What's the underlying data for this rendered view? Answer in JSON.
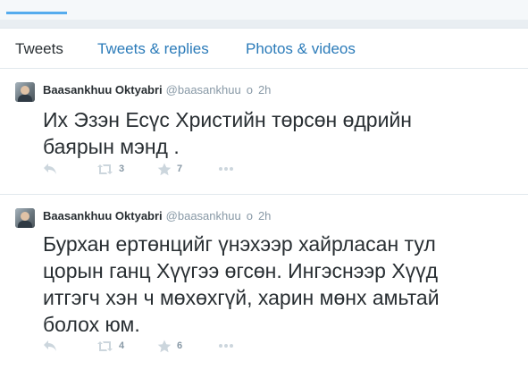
{
  "tabs": [
    {
      "label": "Tweets",
      "active": true
    },
    {
      "label": "Tweets & replies",
      "active": false
    },
    {
      "label": "Photos & videos",
      "active": false
    }
  ],
  "tweets": [
    {
      "name": "Baasankhuu Oktyabri",
      "handle": "@baasankhuu",
      "dot": "o",
      "time": "2h",
      "text": "Их Эзэн Есүс Христийн төрсөн өдрийн\nбаярын мэнд .",
      "retweets": "3",
      "favorites": "7",
      "icons": [
        "reply-icon",
        "retweet-icon",
        "favorite-icon",
        "more-icon"
      ]
    },
    {
      "name": "Baasankhuu Oktyabri",
      "handle": "@baasankhuu",
      "dot": "o",
      "time": "2h",
      "text": "Бурхан ертөнцийг үнэхээр хайрласан тул\nцорын ганц Хүүгээ өгсөн. Ингэснээр Хүүд\nитгэгч хэн ч мөхөхгүй, харин мөнх амьтай\nболох юм.",
      "retweets": "4",
      "favorites": "6",
      "icons": [
        "reply-icon",
        "retweet-icon",
        "favorite-icon",
        "more-icon"
      ]
    }
  ],
  "colors": {
    "link": "#2b7bb9",
    "text": "#292f33",
    "muted": "#8899a6",
    "icon": "#ccd6dd",
    "border": "#e1e8ed"
  }
}
